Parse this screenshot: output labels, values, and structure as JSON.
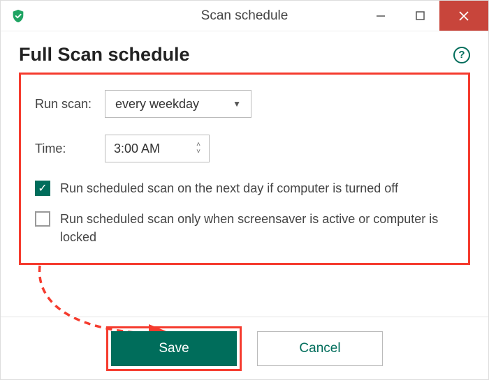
{
  "window": {
    "title": "Scan schedule"
  },
  "heading": "Full Scan schedule",
  "form": {
    "runScanLabel": "Run scan:",
    "runScanValue": "every weekday",
    "timeLabel": "Time:",
    "timeValue": "3:00 AM",
    "option1": {
      "checked": true,
      "label": "Run scheduled scan on the next day if computer is turned off"
    },
    "option2": {
      "checked": false,
      "label": "Run scheduled scan only when screensaver is active or computer is locked"
    }
  },
  "buttons": {
    "save": "Save",
    "cancel": "Cancel"
  },
  "colors": {
    "accent": "#006d5b",
    "highlight": "#f53b2e"
  }
}
